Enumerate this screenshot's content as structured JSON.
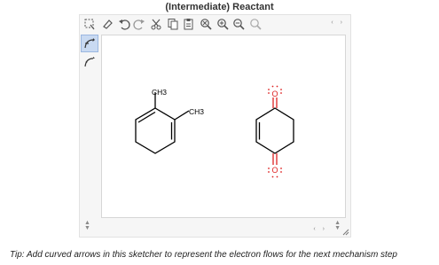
{
  "title": "(Intermediate) Reactant",
  "toolbar": {
    "buttons": [
      {
        "name": "select-tool",
        "icon": "lasso-select-icon"
      },
      {
        "name": "erase",
        "icon": "eraser-icon"
      },
      {
        "name": "undo",
        "icon": "undo-icon"
      },
      {
        "name": "redo",
        "icon": "redo-icon"
      },
      {
        "name": "cut",
        "icon": "scissors-icon"
      },
      {
        "name": "copy",
        "icon": "copy-icon"
      },
      {
        "name": "paste",
        "icon": "paste-icon"
      },
      {
        "name": "zoom-reset",
        "icon": "zoom-reset-icon"
      },
      {
        "name": "zoom-in",
        "icon": "zoom-in-icon"
      },
      {
        "name": "zoom-out",
        "icon": "zoom-out-icon"
      },
      {
        "name": "zoom-fit",
        "icon": "zoom-fit-icon"
      }
    ],
    "scroll_arrows": "‹ ›"
  },
  "sidebar": {
    "tools": [
      {
        "name": "curved-arrow-pair",
        "icon": "curved-arrow-electron-pair-icon",
        "active": true
      },
      {
        "name": "curved-arrow-single",
        "icon": "curved-arrow-single-electron-icon",
        "active": false
      }
    ]
  },
  "molecules": {
    "diene": {
      "substituent_1": "CH3",
      "substituent_2": "CH3"
    },
    "quinone": {
      "atom_top": "O",
      "atom_bottom": "O"
    }
  },
  "colors": {
    "oxygen": "#dd2222",
    "bond": "#000000",
    "active_tool": "#c9daf2"
  },
  "bottom_scroll_arrows": "‹ ›",
  "tip": "Tip: Add curved arrows in this sketcher to represent the electron flows for the next mechanism step"
}
